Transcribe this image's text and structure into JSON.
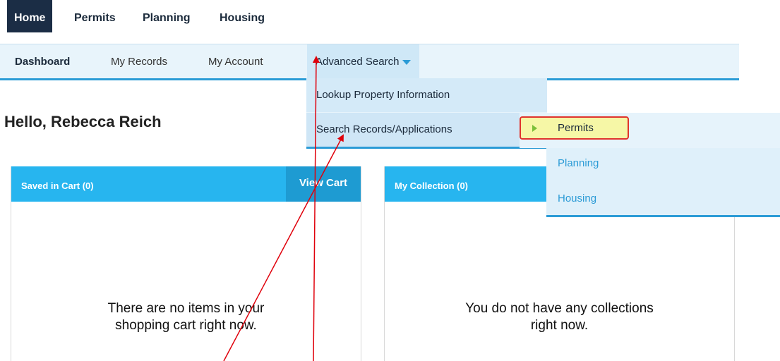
{
  "top_nav": {
    "tabs": [
      {
        "label": "Home"
      },
      {
        "label": "Permits"
      },
      {
        "label": "Planning"
      },
      {
        "label": "Housing"
      }
    ]
  },
  "sub_nav": {
    "items": [
      {
        "label": "Dashboard"
      },
      {
        "label": "My Records"
      },
      {
        "label": "My Account"
      },
      {
        "label": "Advanced Search"
      }
    ]
  },
  "greeting": "Hello, Rebecca Reich",
  "dropdown": {
    "items": [
      {
        "label": "Lookup Property Information"
      },
      {
        "label": "Search Records/Applications"
      }
    ]
  },
  "submenu": {
    "items": [
      {
        "label": "Permits"
      },
      {
        "label": "Planning"
      },
      {
        "label": "Housing"
      }
    ]
  },
  "cards": {
    "cart": {
      "title": "Saved in Cart (0)",
      "action": "View Cart",
      "empty_line1": "There are no items in your",
      "empty_line2": "shopping cart right now."
    },
    "collection": {
      "title": "My Collection (0)",
      "empty_line1": "You do not have any collections",
      "empty_line2": "right now."
    }
  },
  "colors": {
    "nav_dark": "#1b2d45",
    "accent": "#2b9bd6",
    "card_header": "#27b5ef",
    "highlight_fill": "#f6f7a6",
    "highlight_border": "#e0342c",
    "annotation_arrow": "#e0000b"
  }
}
